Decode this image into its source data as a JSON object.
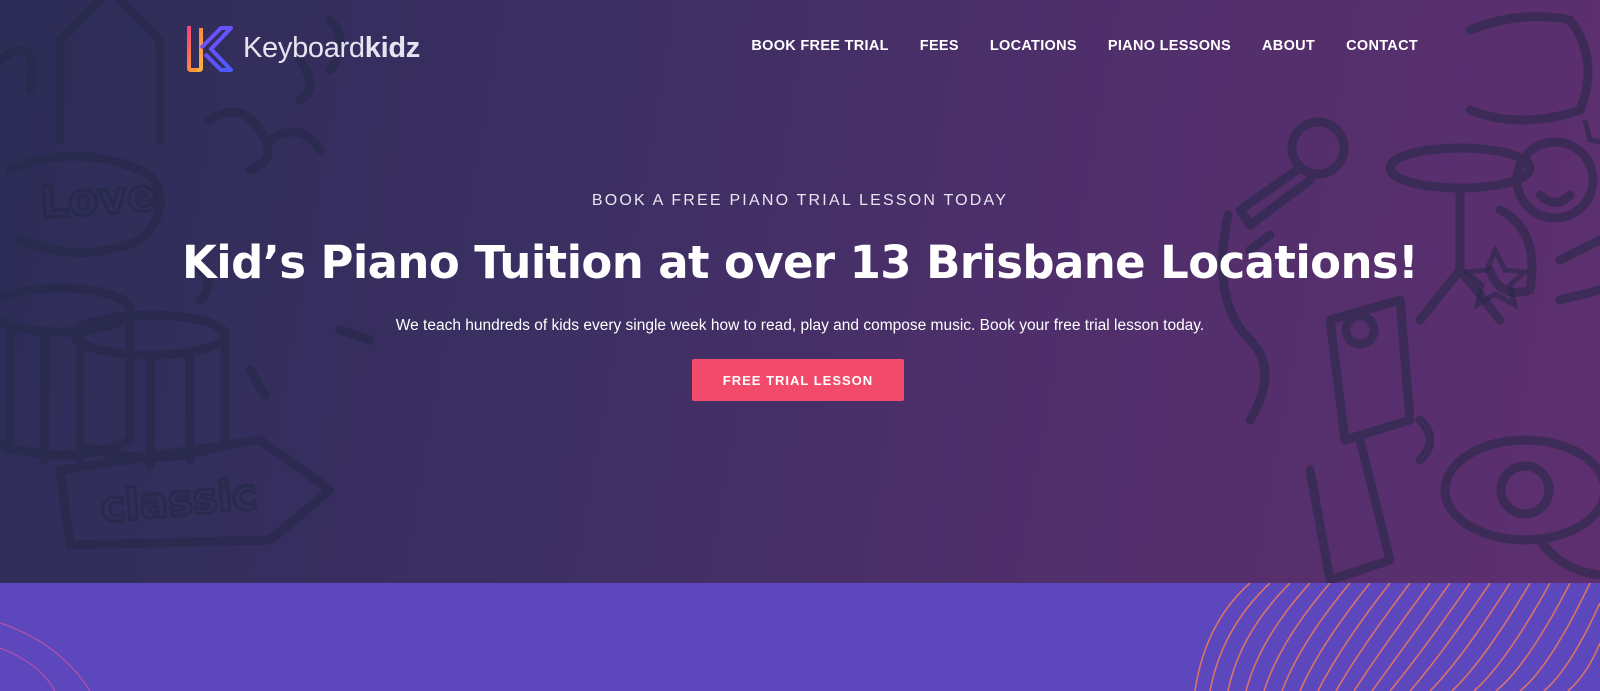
{
  "header": {
    "logo": {
      "text_regular": "Keyboard",
      "text_bold": "kidz"
    },
    "nav": [
      {
        "label": "BOOK FREE TRIAL"
      },
      {
        "label": "FEES"
      },
      {
        "label": "LOCATIONS"
      },
      {
        "label": "PIANO LESSONS"
      },
      {
        "label": "ABOUT"
      },
      {
        "label": "CONTACT"
      }
    ]
  },
  "hero": {
    "eyebrow": "BOOK A FREE PIANO TRIAL LESSON TODAY",
    "headline": "Kid’s Piano Tuition at over 13 Brisbane Locations!",
    "subtext": "We teach hundreds of kids every single week how to read, play and compose music. Book your free trial lesson today.",
    "cta_label": "FREE TRIAL LESSON",
    "doodle_words": [
      "Love",
      "classic"
    ]
  },
  "colors": {
    "hero_gradient_start": "#2d2d57",
    "hero_gradient_end": "#5e2f6f",
    "cta": "#f24a6b",
    "band": "#5c47bd",
    "band_lines": "#f07a5a"
  }
}
